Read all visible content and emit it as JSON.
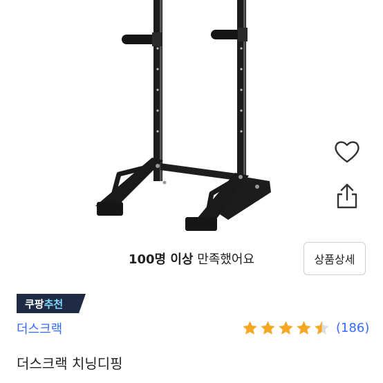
{
  "social_proof": {
    "strong": "100명 이상",
    "rest": " 만족했어요"
  },
  "detail_button_label": "상품상세",
  "badge": {
    "part1": "쿠팡",
    "part2": "추천",
    "bg_color": "#1f2a44",
    "accent_color": "#7fdcff"
  },
  "brand": "더스크랙",
  "rating": {
    "stars": 4.5,
    "max": 5,
    "count": "(186)",
    "star_color": "#f5a623"
  },
  "product_title": "더스크랙 치닝디핑",
  "icons": {
    "wishlist": "heart-icon",
    "share": "share-icon"
  },
  "colors": {
    "link": "#346aff"
  }
}
